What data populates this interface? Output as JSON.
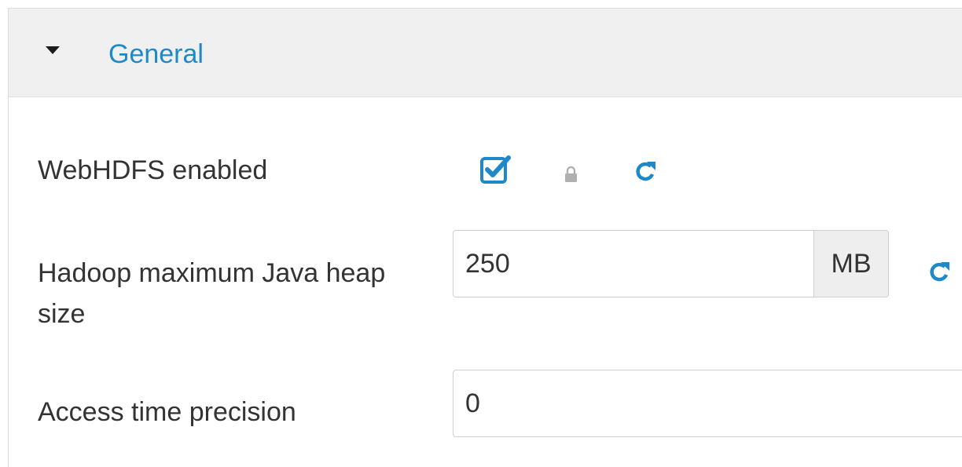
{
  "panel": {
    "title": "General",
    "title_color": "#1e88c9",
    "header_background": "#f0f0f0",
    "caret_icon": "caret-down-icon"
  },
  "fields": {
    "webhdfs": {
      "label": "WebHDFS enabled",
      "checked": true,
      "checkbox_color": "#1e88c9",
      "icons": [
        "checkbox-checked-icon",
        "lock-icon",
        "refresh-icon"
      ]
    },
    "heap_size": {
      "label": "Hadoop maximum Java heap size",
      "value": "250",
      "unit": "MB",
      "icons": [
        "refresh-icon"
      ]
    },
    "access_time": {
      "label": "Access time precision",
      "value": "0"
    }
  },
  "colors": {
    "accent": "#1e88c9",
    "text": "#333333",
    "lock": "#b0b0b0"
  }
}
